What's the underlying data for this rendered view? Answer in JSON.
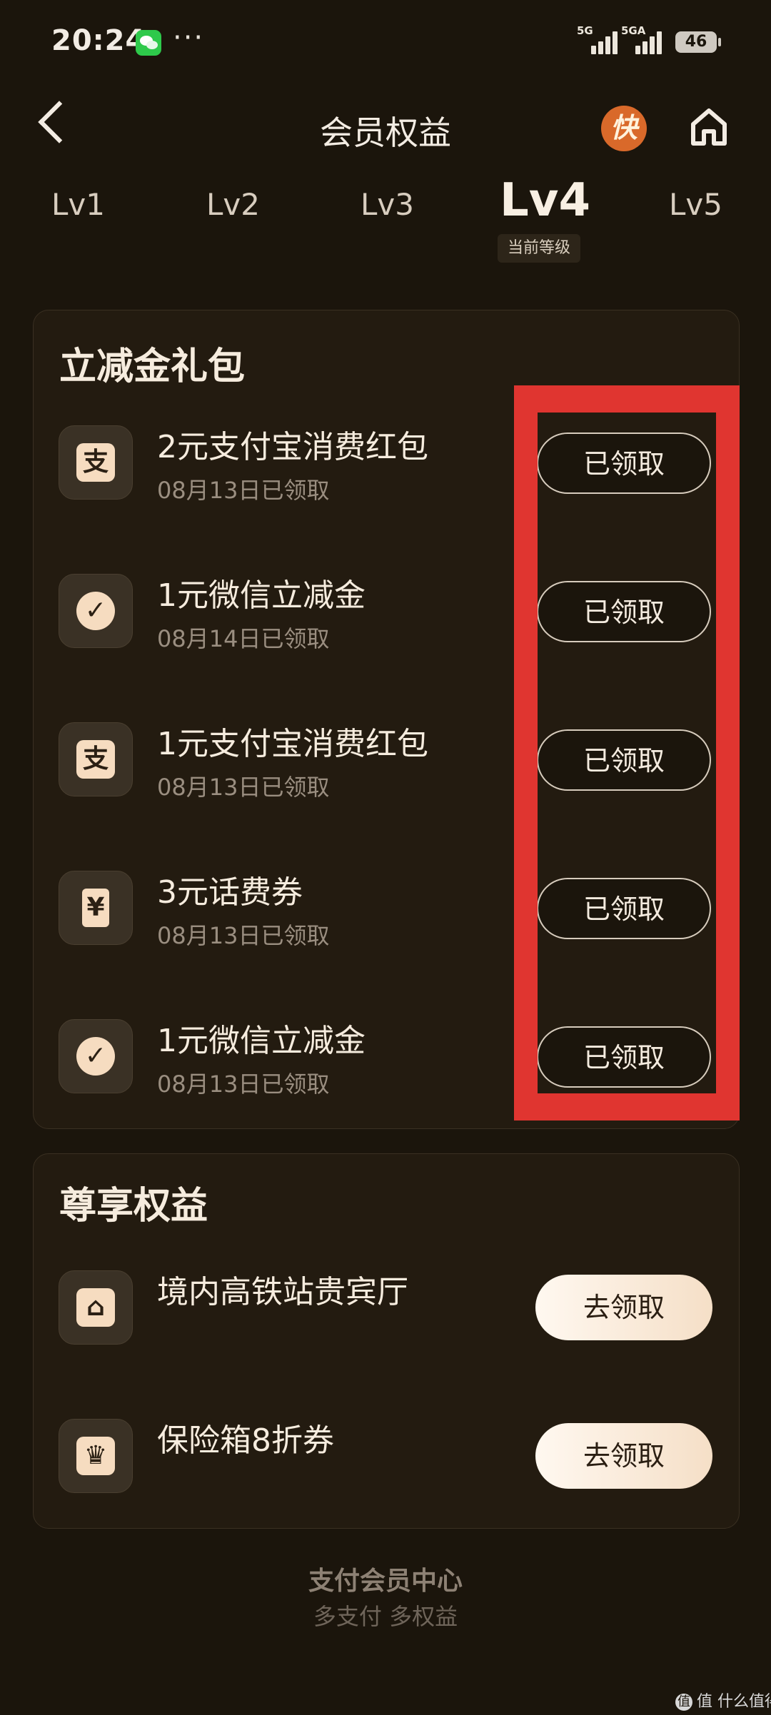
{
  "status": {
    "time": "20:24",
    "more": "···",
    "signal1": "5G",
    "signal2": "5GA",
    "battery": "46"
  },
  "nav": {
    "title": "会员权益",
    "kuai": "快"
  },
  "levels": {
    "items": [
      "Lv1",
      "Lv2",
      "Lv3",
      "Lv4",
      "Lv5"
    ],
    "current_label": "当前等级"
  },
  "cash_pack": {
    "title": "立减金礼包",
    "items": [
      {
        "icon": "alipay-icon",
        "glyph": "支",
        "title": "2元支付宝消费红包",
        "sub": "08月13日已领取",
        "button": "已领取"
      },
      {
        "icon": "wechat-pay-icon",
        "glyph": "✓",
        "title": "1元微信立减金",
        "sub": "08月14日已领取",
        "button": "已领取"
      },
      {
        "icon": "alipay-icon",
        "glyph": "支",
        "title": "1元支付宝消费红包",
        "sub": "08月13日已领取",
        "button": "已领取"
      },
      {
        "icon": "phone-bill-icon",
        "glyph": "¥",
        "title": "3元话费券",
        "sub": "08月13日已领取",
        "button": "已领取"
      },
      {
        "icon": "wechat-pay-icon",
        "glyph": "✓",
        "title": "1元微信立减金",
        "sub": "08月13日已领取",
        "button": "已领取"
      }
    ]
  },
  "vip": {
    "title": "尊享权益",
    "items": [
      {
        "icon": "lounge-sofa-icon",
        "glyph": "⌂",
        "title": "境内高铁站贵宾厅",
        "button": "去领取"
      },
      {
        "icon": "crown-icon",
        "glyph": "♛",
        "title": "保险箱8折券",
        "button": "去领取"
      }
    ]
  },
  "footer": {
    "title": "支付会员中心",
    "sub": "多支付 多权益"
  },
  "watermark": "值 什么值得买",
  "colors": {
    "background": "#1b150c",
    "card": "#231b10",
    "accent": "#f6dcc0",
    "annotation": "#e03530"
  }
}
